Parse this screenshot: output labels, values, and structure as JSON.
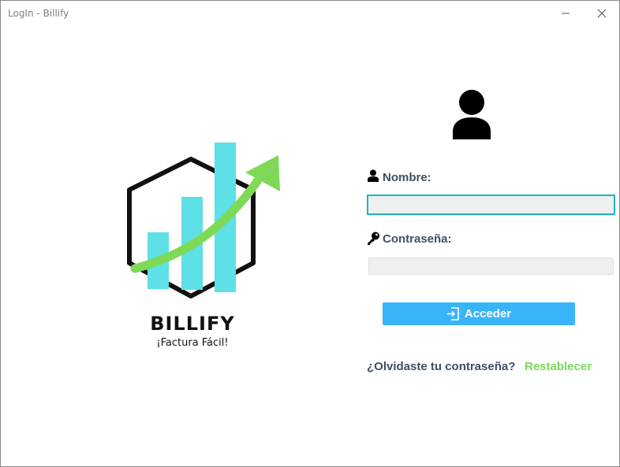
{
  "window": {
    "title": "LogIn - Billify"
  },
  "logo": {
    "title": "BILLIFY",
    "subtitle": "¡Factura Fácil!",
    "colors": {
      "bars": "#5de0e6",
      "arrow": "#7ed957",
      "hexagon": "#111111"
    }
  },
  "form": {
    "username_label": "Nombre:",
    "username_value": "",
    "password_label": "Contraseña:",
    "password_value": "",
    "login_button_label": "Acceder",
    "forgot_text": "¿Olvidaste tu contraseña?",
    "reset_link_label": "Restablecer"
  },
  "colors": {
    "label_text": "#3e4f65",
    "accent_button": "#3ab4f8",
    "input_focus_border": "#1bb3d1",
    "link": "#7ad85a"
  }
}
